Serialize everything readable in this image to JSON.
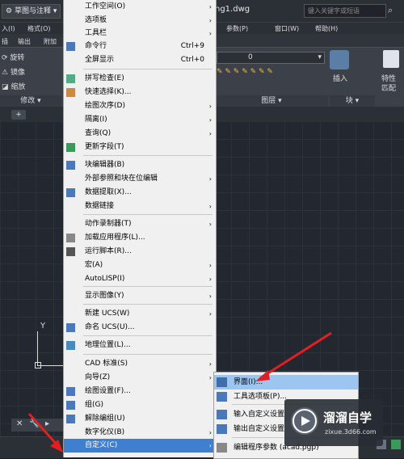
{
  "title_bar": {
    "workspace": "草图与注释",
    "filename": "ng1.dwg",
    "search_placeholder": "键入关键字或短语"
  },
  "menubar": {
    "items": [
      "入(I)",
      "格式(O)",
      "参数(P)",
      "窗口(W)",
      "帮助(H)"
    ]
  },
  "ribbon_tabs": {
    "items": [
      "插",
      "输出",
      "附加"
    ]
  },
  "ribbon": {
    "modify_tools": [
      "旋转",
      "镜像",
      "缩放"
    ],
    "modify_title": "修改",
    "layer_value": "0",
    "layers_title": "图层",
    "insert_label": "插入",
    "block_title": "块",
    "props_label": [
      "特性",
      "匹配"
    ]
  },
  "doc_tab": {
    "plus": "+"
  },
  "canvas": {
    "ucs_y": "Y"
  },
  "menu": {
    "items": [
      {
        "label": "工作空间(O)",
        "arrow": "›"
      },
      {
        "label": "选项板",
        "arrow": "›"
      },
      {
        "label": "工具栏",
        "arrow": "›"
      },
      {
        "label": "命令行",
        "shortcut": "Ctrl+9"
      },
      {
        "label": "全屏显示",
        "shortcut": "Ctrl+0"
      },
      {
        "label": "拼写检查(E)"
      },
      {
        "label": "快速选择(K)..."
      },
      {
        "label": "绘图次序(D)",
        "arrow": "›"
      },
      {
        "label": "隔离(I)",
        "arrow": "›"
      },
      {
        "label": "查询(Q)",
        "arrow": "›"
      },
      {
        "label": "更新字段(T)"
      },
      {
        "label": "块编辑器(B)"
      },
      {
        "label": "外部参照和块在位编辑",
        "arrow": "›"
      },
      {
        "label": "数据提取(X)..."
      },
      {
        "label": "数据链接",
        "arrow": "›"
      },
      {
        "label": "动作录制器(T)",
        "arrow": "›"
      },
      {
        "label": "加载应用程序(L)..."
      },
      {
        "label": "运行脚本(R)..."
      },
      {
        "label": "宏(A)",
        "arrow": "›"
      },
      {
        "label": "AutoLISP(I)",
        "arrow": "›"
      },
      {
        "label": "显示图像(Y)",
        "arrow": "›"
      },
      {
        "label": "新建 UCS(W)",
        "arrow": "›"
      },
      {
        "label": "命名 UCS(U)..."
      },
      {
        "label": "地理位置(L)..."
      },
      {
        "label": "CAD 标准(S)",
        "arrow": "›"
      },
      {
        "label": "向导(Z)",
        "arrow": "›"
      },
      {
        "label": "绘图设置(F)..."
      },
      {
        "label": "组(G)"
      },
      {
        "label": "解除编组(U)"
      },
      {
        "label": "数字化仪(B)",
        "arrow": "›"
      },
      {
        "label": "自定义(C)",
        "arrow": "›"
      }
    ]
  },
  "submenu": {
    "items": [
      {
        "label": "界面(I)..."
      },
      {
        "label": "工具选项板(P)..."
      },
      {
        "label": "输入自定义设置"
      },
      {
        "label": "输出自定义设置"
      },
      {
        "label": "编辑程序参数 (acad.pgp)"
      }
    ]
  },
  "watermark": {
    "name": "溜溜自学",
    "url": "zixue.3d66.com"
  },
  "colors": {
    "highlight": "#3f7fd0",
    "submenu_highlight": "#9cc6f0",
    "arrow": "#e02020"
  }
}
